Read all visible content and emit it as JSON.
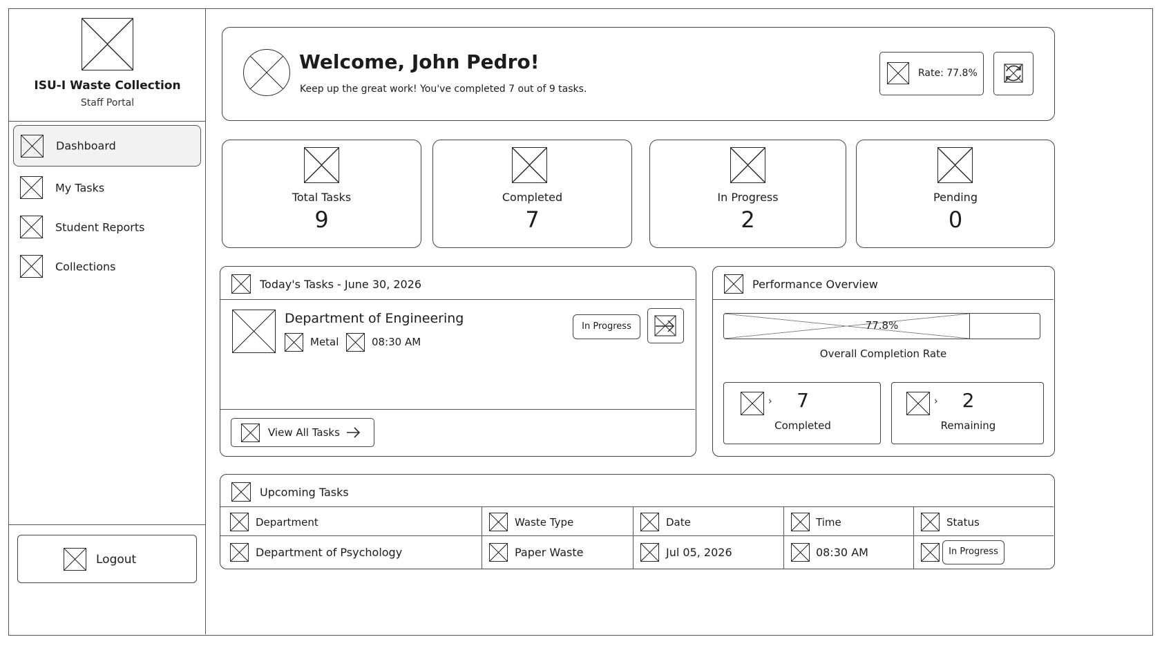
{
  "sidebar": {
    "app_title": "ISU-I Waste Collection",
    "app_subtitle": "Staff Portal",
    "items": [
      {
        "label": "Dashboard",
        "active": true
      },
      {
        "label": "My Tasks"
      },
      {
        "label": "Student Reports"
      },
      {
        "label": "Collections"
      }
    ],
    "logout_label": "Logout"
  },
  "welcome": {
    "title": "Welcome, John Pedro!",
    "message": "Keep up the great work! You've completed 7 out of 9 tasks.",
    "rate_label": "Rate: 77.8%"
  },
  "stats": [
    {
      "label": "Total Tasks",
      "value": "9"
    },
    {
      "label": "Completed",
      "value": "7"
    },
    {
      "label": "In Progress",
      "value": "2"
    },
    {
      "label": "Pending",
      "value": "0"
    }
  ],
  "today": {
    "title": "Today's Tasks - June 30, 2026",
    "task": {
      "department": "Department of Engineering",
      "waste_type": "Metal",
      "time": "08:30 AM",
      "status": "In Progress"
    },
    "view_all_label": "View All Tasks"
  },
  "performance": {
    "title": "Performance Overview",
    "progress_text": "77.8%",
    "progress_fraction": 0.778,
    "caption": "Overall Completion Rate",
    "completed": {
      "value": "7",
      "label": "Completed",
      "chevron": "›"
    },
    "remaining": {
      "value": "2",
      "label": "Remaining",
      "chevron": "›"
    }
  },
  "upcoming": {
    "title": "Upcoming Tasks",
    "columns": [
      "Department",
      "Waste Type",
      "Date",
      "Time",
      "Status"
    ],
    "rows": [
      {
        "department": "Department of Psychology",
        "waste_type": "Paper Waste",
        "date": "Jul 05, 2026",
        "time": "08:30 AM",
        "status": "In Progress"
      }
    ]
  }
}
